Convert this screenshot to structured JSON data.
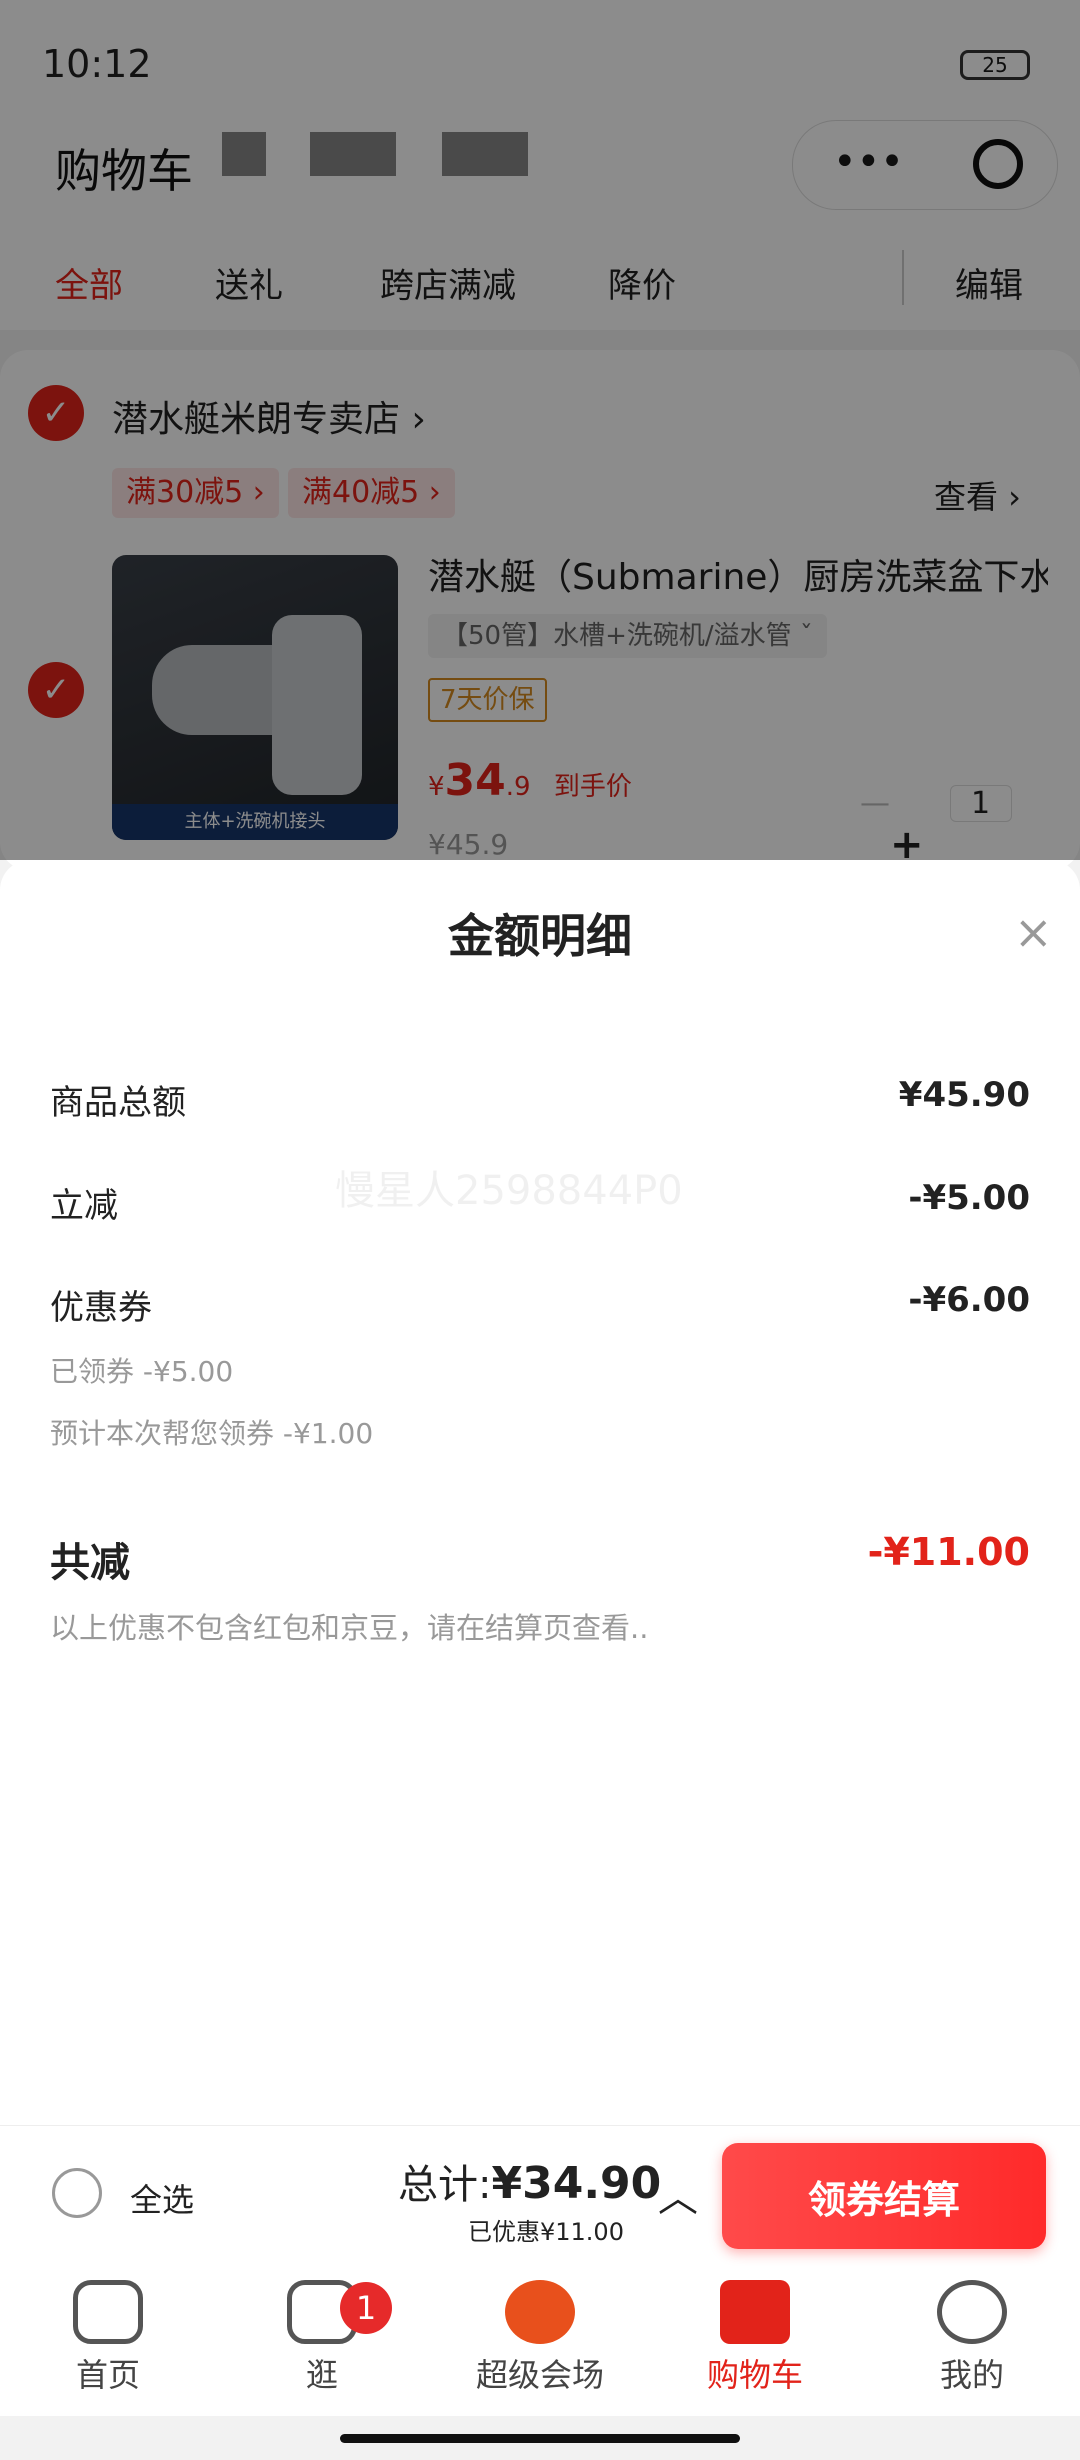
{
  "status": {
    "time": "10:12",
    "battery": "25"
  },
  "header": {
    "title": "购物车"
  },
  "tabs": [
    "全部",
    "送礼",
    "跨店满减",
    "降价",
    "编辑"
  ],
  "shop": {
    "name": "潜水艇米朗专卖店 ›",
    "promos": [
      "满30减5 ›",
      "满40减5 ›"
    ],
    "view_more": "查看 ›"
  },
  "product": {
    "image_banner": "主体+洗碗机接头",
    "title": "潜水艇（Submarine）厨房洗菜盆下水",
    "spec": "【50管】水槽+洗碗机/溢水管 ˇ",
    "guarantee": "7天价保",
    "price_symbol": "¥",
    "price_int": "34",
    "price_dec": ".9",
    "price_note": "到手价",
    "orig_price": "¥45.9",
    "quantity": "1"
  },
  "sheet": {
    "title": "金额明细",
    "close": "×",
    "rows": [
      {
        "label": "商品总额",
        "value": "¥45.90"
      },
      {
        "label": "立减",
        "value": "-¥5.00"
      },
      {
        "label": "优惠券",
        "value": "-¥6.00"
      }
    ],
    "coupon_sub": [
      "已领券 -¥5.00",
      "预计本次帮您领券 -¥1.00"
    ],
    "total_label": "共减",
    "total_value": "-¥11.00",
    "note": "以上优惠不包含红包和京豆，请在结算页查看..",
    "watermark": "慢星人2598844P0"
  },
  "checkout": {
    "select_all": "全选",
    "total_prefix": "总计:",
    "total_amount": "¥34.90",
    "saved": "已优惠¥11.00",
    "button": "领券结算"
  },
  "tabbar": {
    "items": [
      "首页",
      "逛",
      "超级会场",
      "购物车",
      "我的"
    ],
    "badge": "1"
  },
  "colors": {
    "accent": "#e2231a",
    "button": "#ff3030"
  }
}
